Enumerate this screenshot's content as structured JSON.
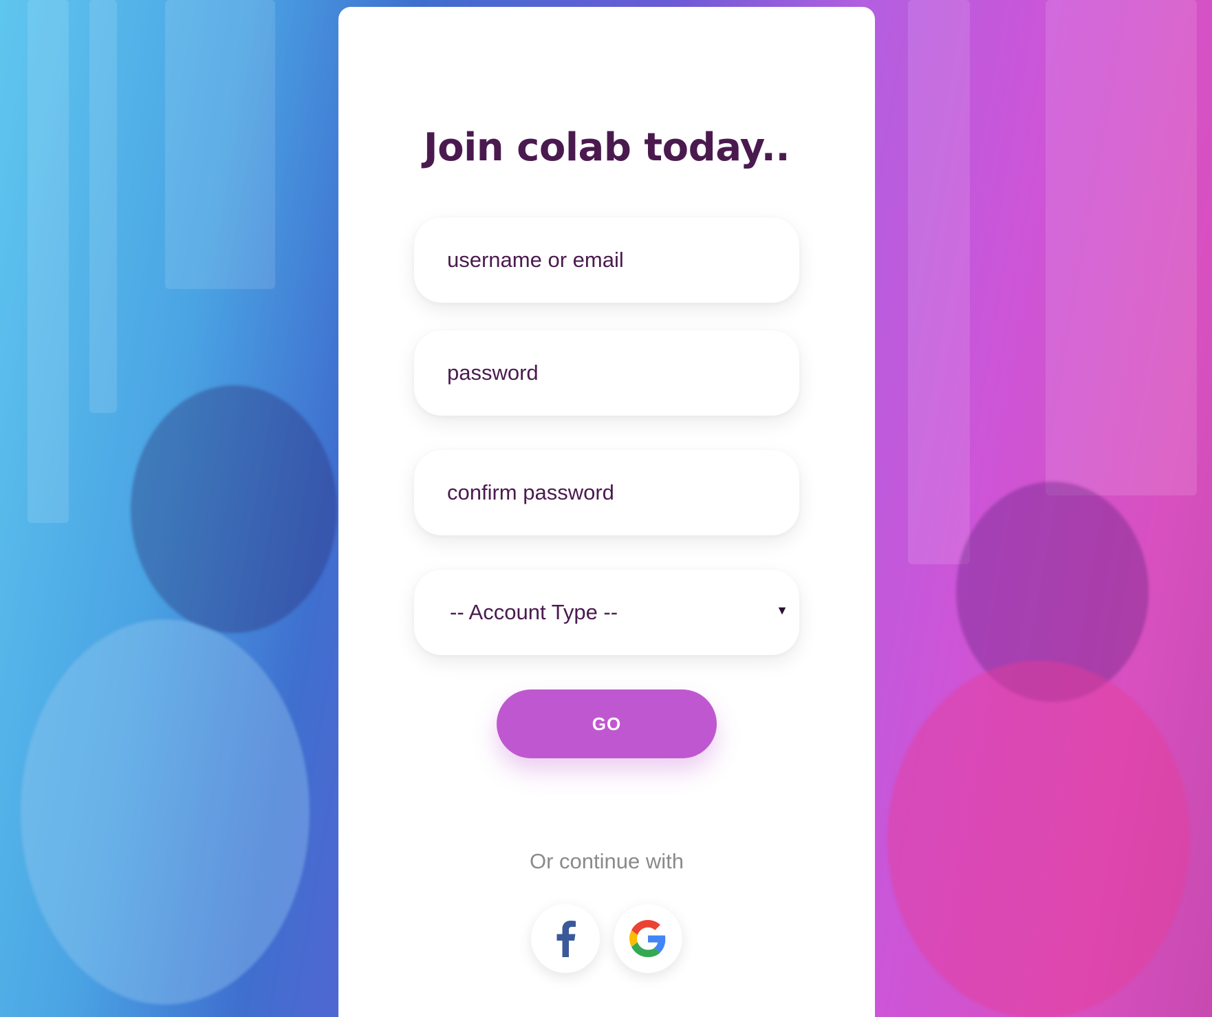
{
  "signup": {
    "title": "Join colab today..",
    "username_placeholder": "username or email",
    "password_placeholder": "password",
    "confirm_password_placeholder": "confirm password",
    "account_type_selected": "-- Account Type --",
    "submit_label": "GO",
    "or_continue_text": "Or continue with",
    "social": [
      {
        "name": "facebook",
        "icon": "facebook-icon",
        "color": "#3b5998"
      },
      {
        "name": "google",
        "icon": "google-icon"
      }
    ]
  },
  "colors": {
    "title": "#4a1a4f",
    "button": "#bf58d0",
    "muted_text": "#8a8a8a"
  }
}
